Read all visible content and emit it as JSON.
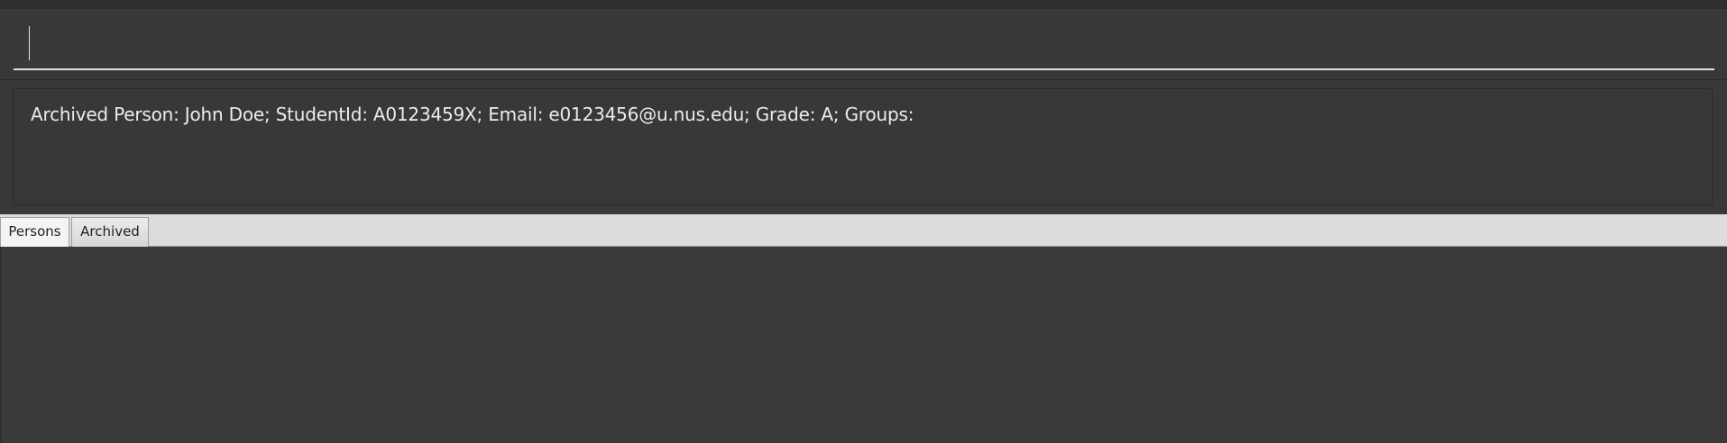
{
  "command": {
    "value": "",
    "placeholder": ""
  },
  "result": {
    "text": "Archived Person: John Doe; StudentId: A0123459X; Email: e0123456@u.nus.edu; Grade: A; Groups: "
  },
  "tabs": [
    {
      "label": "Persons",
      "selected": true
    },
    {
      "label": "Archived",
      "selected": false
    }
  ],
  "colors": {
    "background": "#3a3a3a",
    "text": "#ececec",
    "tab_bar": "#dcdcdc",
    "input_underline": "#e0e0e0"
  }
}
